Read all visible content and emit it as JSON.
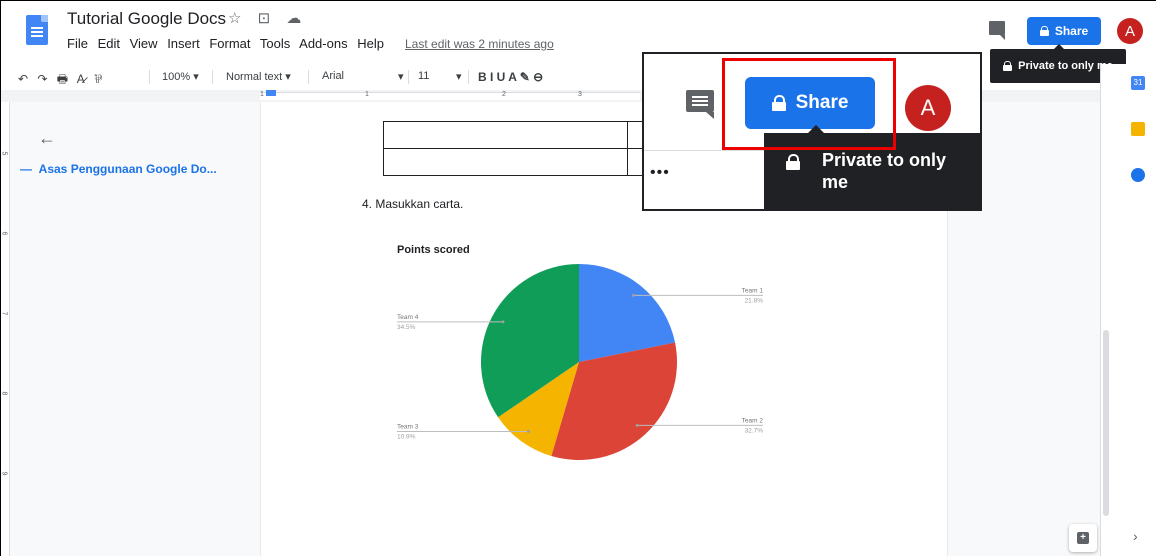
{
  "header": {
    "doc_title": "Tutorial Google Docs",
    "title_icons": "☆ ⊡ ☁",
    "menu": [
      "File",
      "Edit",
      "View",
      "Insert",
      "Format",
      "Tools",
      "Add-ons",
      "Help"
    ],
    "last_edit": "Last edit was 2 minutes ago",
    "share_label": "Share",
    "avatar_letter": "A",
    "tooltip": "Private to only me"
  },
  "toolbar": {
    "undo_redo_print": "↶ ↷ 🖶 A̷ ⅌",
    "zoom": "100%",
    "style": "Normal text",
    "font": "Arial",
    "size": "11",
    "format_icons": "B  I  U  A  ✎  ⊖"
  },
  "ruler": {
    "n1": "1",
    "n2": "1",
    "n3": "2",
    "n4": "3"
  },
  "vruler": {
    "n5": "5",
    "n6": "6",
    "n7": "7",
    "n8": "8",
    "n9": "9"
  },
  "outline": {
    "back": "←",
    "heading": "Asas Penggunaan Google Do..."
  },
  "document": {
    "list_item": "4.   Masukkan carta."
  },
  "chart_data": {
    "type": "pie",
    "title": "Points scored",
    "series": [
      {
        "name": "Team 1",
        "value": 21.8,
        "label": "21.8%",
        "color": "#4285f4"
      },
      {
        "name": "Team 2",
        "value": 32.7,
        "label": "32.7%",
        "color": "#db4437"
      },
      {
        "name": "Team 3",
        "value": 10.9,
        "label": "10.9%",
        "color": "#f4b400"
      },
      {
        "name": "Team 4",
        "value": 34.5,
        "label": "34.5%",
        "color": "#0f9d58"
      }
    ]
  },
  "zoom": {
    "share_label": "Share",
    "avatar_letter": "A",
    "tooltip_line1": "Private to only",
    "tooltip_line2": "me",
    "dots": "•••"
  },
  "side": {
    "chevron": "›"
  },
  "colors": {
    "accent": "#1a73e8",
    "highlight": "#e00000",
    "avatar": "#c5221f"
  }
}
